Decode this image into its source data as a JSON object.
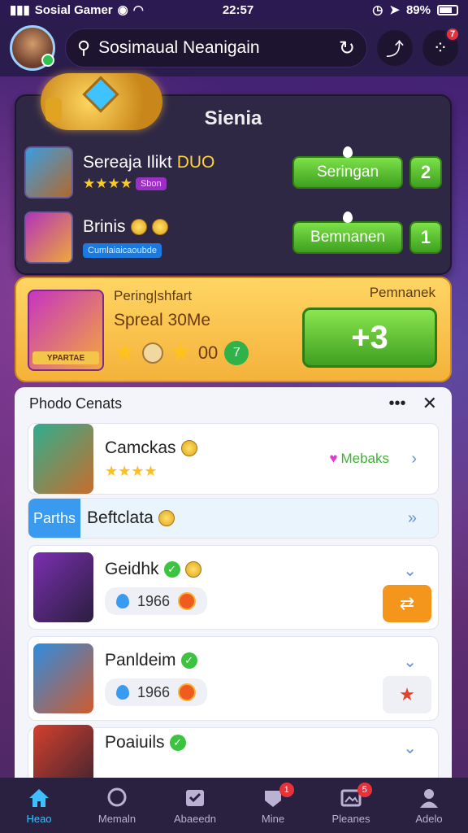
{
  "status_bar": {
    "carrier": "Sosial Gamer",
    "time": "22:57",
    "battery": "89%"
  },
  "search": {
    "value": "Sosimaual Neanigain"
  },
  "header_badge": "7",
  "panel": {
    "title": "Sienia",
    "games": [
      {
        "name": "Sereaja Ilikt",
        "accent": "DUO",
        "tag": "Sbon",
        "button": "Seringan",
        "count": "2"
      },
      {
        "name": "Brinis",
        "tag": "Cumlaiaicaoubde",
        "button": "Bemnanen",
        "count": "1"
      }
    ]
  },
  "promo": {
    "ribbon": "YPARTAE",
    "label1": "Pering|shfart",
    "label2": "Spreal 30Me",
    "value": "00",
    "right_label": "Pemnanek",
    "button": "+3",
    "green_num": "7"
  },
  "list": {
    "title": "Phodo Cenats",
    "items": [
      {
        "name": "Camckas",
        "right_label": "Mebaks"
      },
      {
        "tag": "Parths",
        "name": "Beftclata"
      },
      {
        "name": "Geidhk",
        "value": "1966"
      },
      {
        "name": "Panldeim",
        "value": "1966"
      },
      {
        "name": "Poaiuils"
      }
    ]
  },
  "nav": [
    {
      "label": "Heao",
      "icon": "home-icon",
      "active": true
    },
    {
      "label": "Memaln",
      "icon": "chat-icon"
    },
    {
      "label": "Abaeedn",
      "icon": "inbox-icon"
    },
    {
      "label": "Mine",
      "icon": "badge-icon",
      "badge": "1"
    },
    {
      "label": "Pleanes",
      "icon": "picture-icon",
      "badge": "5"
    },
    {
      "label": "Adelo",
      "icon": "profile-icon"
    }
  ],
  "colors": {
    "accent": "#3ec0ff",
    "green": "#4caf2a",
    "yellow": "#f4b23a",
    "nav_bg": "#2a2140"
  }
}
